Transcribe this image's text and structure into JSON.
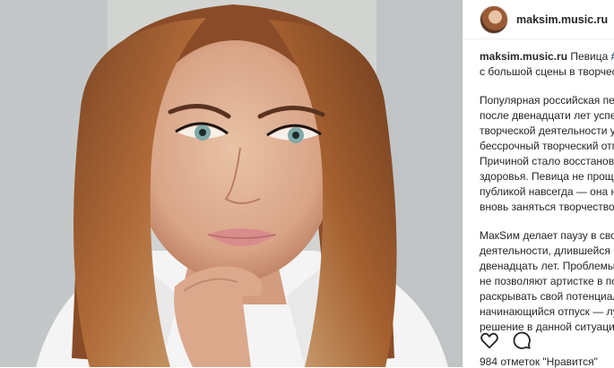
{
  "post": {
    "username": "maksim.music.ru",
    "caption_username": "maksim.music.ru",
    "caption_line1_text": " Певица ",
    "caption_hashtag": "#М",
    "caption_line2": "с большой сцены в творчес",
    "paragraph1": [
      "Популярная российская пев",
      "после двенадцати лет успеш",
      "творческой деятельности у",
      "бессрочный творческий отп",
      "Причиной стало восстановл",
      "здоровья. Певица не проща",
      "публикой навсегда — она н",
      "вновь заняться творчеством"
    ],
    "paragraph2": [
      "МакSим делает паузу в свое",
      "деятельности, длившейся б",
      "двенадцать лет. Проблемы",
      "не позволяют артистке в по",
      "раскрывать свой потенциал",
      "начинающийся отпуск — лу",
      "решение в данной ситуации"
    ],
    "likes_text": "984 отметок \"Нравится\""
  },
  "icons": {
    "like": "heart-icon",
    "comment": "comment-icon"
  },
  "colors": {
    "text": "#262626",
    "hashtag": "#003569",
    "border": "#efefef"
  }
}
